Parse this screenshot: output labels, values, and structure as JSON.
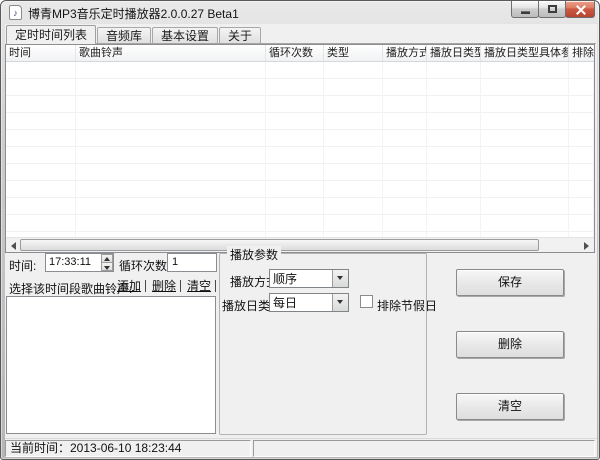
{
  "window": {
    "title": "博青MP3音乐定时播放器2.0.0.27 Beta1"
  },
  "icons": {
    "app_note_glyph": "♪"
  },
  "tabs": {
    "items": [
      {
        "label": "定时时间列表"
      },
      {
        "label": "音频库"
      },
      {
        "label": "基本设置"
      },
      {
        "label": "关于"
      }
    ],
    "active": "定时时间列表"
  },
  "table": {
    "columns": [
      {
        "label": "时间"
      },
      {
        "label": "歌曲铃声"
      },
      {
        "label": "循环次数"
      },
      {
        "label": "类型"
      },
      {
        "label": "播放方式"
      },
      {
        "label": "播放日类型"
      },
      {
        "label": "播放日类型具体参数"
      },
      {
        "label": "排除节假日"
      }
    ],
    "rows": []
  },
  "editor": {
    "time_label": "时间:",
    "time_value": "17:33:11",
    "loop_label": "循环次数:",
    "loop_value": "1",
    "song_select_label": "选择该时间段歌曲铃声:",
    "song_actions": {
      "add": "添加",
      "remove": "删除",
      "clear": "清空"
    },
    "playlist_items": []
  },
  "playback_params": {
    "title": "播放参数",
    "mode_label": "播放方式:",
    "mode_value": "顺序",
    "day_type_label": "播放日类型:",
    "day_type_value": "每日",
    "exclude_holidays_label": "排除节假日",
    "exclude_holidays_checked": false
  },
  "actions": {
    "save": "保存",
    "delete": "删除",
    "clear": "清空"
  },
  "statusbar": {
    "current_time": "当前时间：2013-06-10 18:23:44"
  },
  "colors": {
    "client_bg": "#f0f0f0",
    "close_button_red": "#cf5a45",
    "titlebar_gray_top": "#e9e9e9",
    "titlebar_gray_bottom": "#b5b5b5"
  }
}
